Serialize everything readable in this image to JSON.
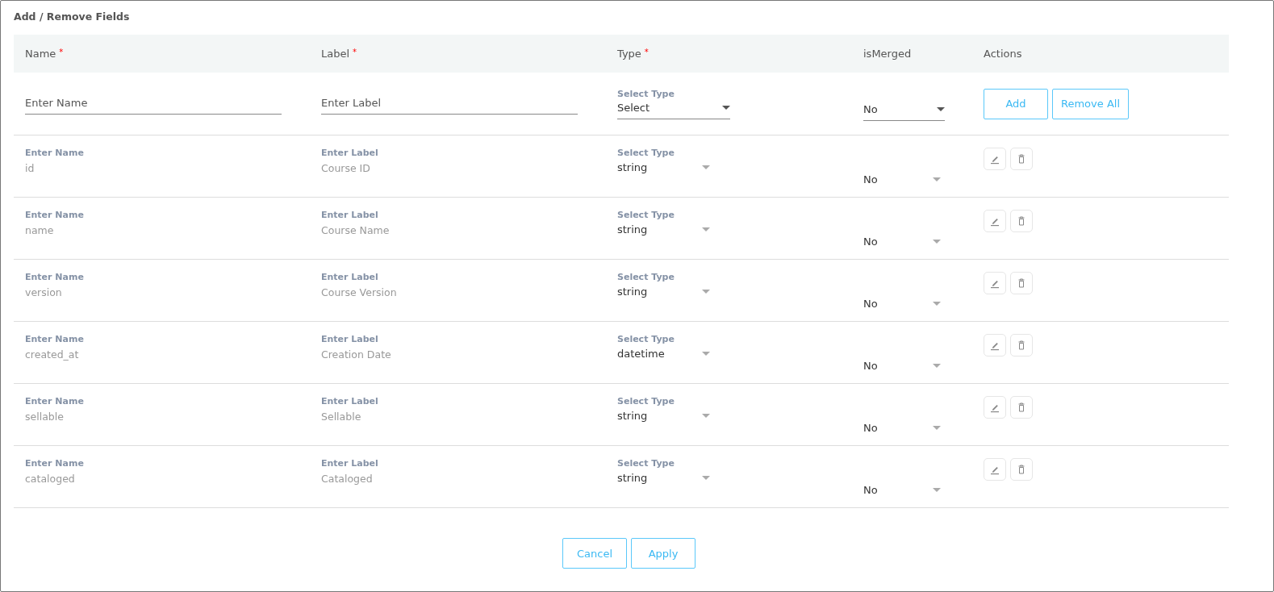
{
  "dialog": {
    "title": "Add / Remove Fields"
  },
  "columns": [
    {
      "label": "Name",
      "required_mark": "*"
    },
    {
      "label": "Label",
      "required_mark": "*"
    },
    {
      "label": "Type",
      "required_mark": "*"
    },
    {
      "label": "isMerged"
    },
    {
      "label": "Actions"
    }
  ],
  "new_row": {
    "name_placeholder": "Enter Name",
    "label_placeholder": "Enter Label",
    "type_caption": "Select Type",
    "type_value": "Select",
    "merged_value": "No",
    "buttons": [
      "Add",
      "Remove All"
    ]
  },
  "rows": [
    {
      "name_caption": "Enter Name",
      "name": "id",
      "label_caption": "Enter Label",
      "label": "Course ID",
      "type_caption": "Select Type",
      "type": "string",
      "merged": "No"
    },
    {
      "name_caption": "Enter Name",
      "name": "name",
      "label_caption": "Enter Label",
      "label": "Course Name",
      "type_caption": "Select Type",
      "type": "string",
      "merged": "No"
    },
    {
      "name_caption": "Enter Name",
      "name": "version",
      "label_caption": "Enter Label",
      "label": "Course Version",
      "type_caption": "Select Type",
      "type": "string",
      "merged": "No"
    },
    {
      "name_caption": "Enter Name",
      "name": "created_at",
      "label_caption": "Enter Label",
      "label": "Creation Date",
      "type_caption": "Select Type",
      "type": "datetime",
      "merged": "No"
    },
    {
      "name_caption": "Enter Name",
      "name": "sellable",
      "label_caption": "Enter Label",
      "label": "Sellable",
      "type_caption": "Select Type",
      "type": "string",
      "merged": "No"
    },
    {
      "name_caption": "Enter Name",
      "name": "cataloged",
      "label_caption": "Enter Label",
      "label": "Cataloged",
      "type_caption": "Select Type",
      "type": "string",
      "merged": "No"
    }
  ],
  "footer_buttons": [
    "Cancel",
    "Apply"
  ]
}
